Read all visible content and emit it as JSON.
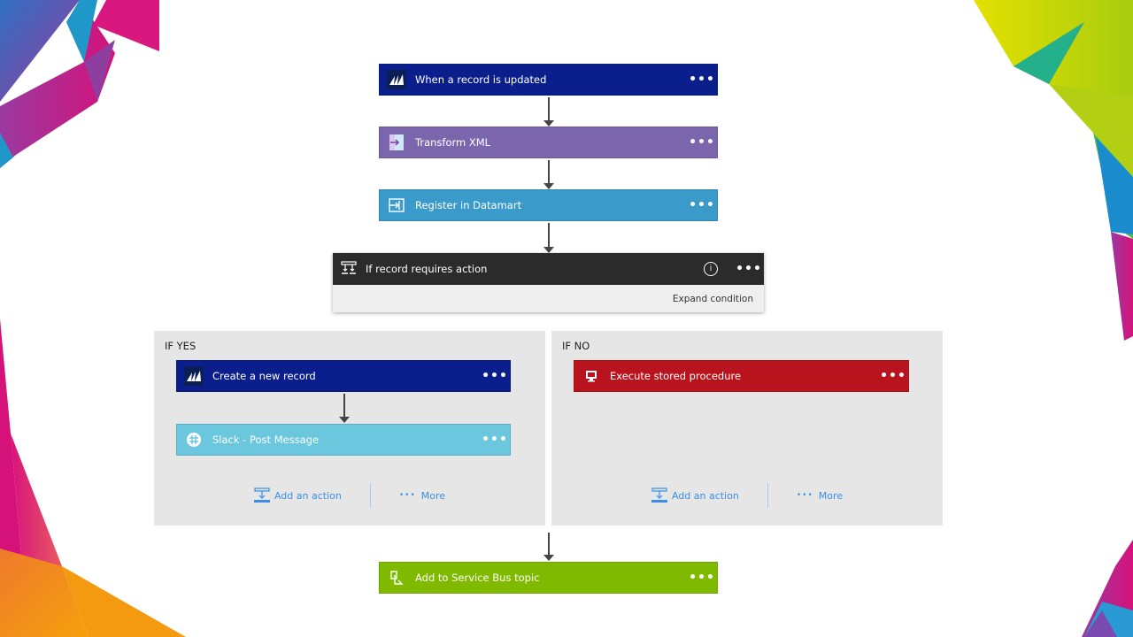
{
  "flow": {
    "steps": [
      {
        "title": "When a record is updated",
        "icon": "dynamics-crm-icon",
        "color": "#0a1e8c"
      },
      {
        "title": "Transform XML",
        "icon": "transform-xml-icon",
        "color": "#7b66ad"
      },
      {
        "title": "Register in Datamart",
        "icon": "datamart-icon",
        "color": "#3a9ac9"
      }
    ],
    "condition": {
      "title": "If record requires action",
      "icon": "condition-icon",
      "info_icon": "info-icon",
      "expand_label": "Expand condition",
      "color": "#2b2b2b"
    },
    "branch_yes": {
      "label": "IF YES",
      "steps": [
        {
          "title": "Create a new record",
          "icon": "dynamics-crm-icon",
          "color": "#0a1e8c"
        },
        {
          "title": "Slack - Post Message",
          "icon": "slack-icon",
          "color": "#6ac7dd"
        }
      ],
      "add_action_label": "Add an action",
      "more_label": "More"
    },
    "branch_no": {
      "label": "IF NO",
      "steps": [
        {
          "title": "Execute stored procedure",
          "icon": "sql-server-icon",
          "color": "#b9141d"
        }
      ],
      "add_action_label": "Add an action",
      "more_label": "More"
    },
    "final_step": {
      "title": "Add to Service Bus topic",
      "icon": "service-bus-icon",
      "color": "#7fba00"
    },
    "more_glyph": "•••",
    "link_color": "#3a8ee6"
  }
}
